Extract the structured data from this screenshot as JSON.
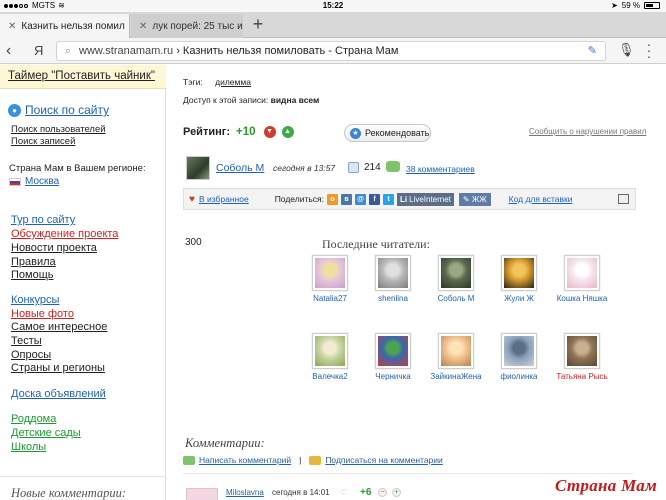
{
  "status": {
    "carrier": "MGTS",
    "time": "15:22",
    "battery": "59 %"
  },
  "tabs": [
    {
      "label": "Казнить нельзя помил",
      "active": true
    },
    {
      "label": "лук порей: 25 тыс изо",
      "active": false
    }
  ],
  "address": {
    "domain": "www.stranamam.ru",
    "separator": " › ",
    "title": "Казнить нельзя помиловать - Страна Мам"
  },
  "sidebar": {
    "timer": "Таймер \"Поставить чайник\"",
    "search": "Поиск по сайту",
    "search_users": "Поиск пользователей",
    "search_posts": "Поиск записей",
    "region_label": "Страна Мам в Вашем регионе:",
    "region": "Москва",
    "links_group1": [
      {
        "label": "Тур по сайту",
        "color": "blue"
      },
      {
        "label": "Обсуждение проекта",
        "color": "red"
      },
      {
        "label": "Новости проекта",
        "color": "dark"
      },
      {
        "label": "Правила",
        "color": "dark"
      },
      {
        "label": "Помощь",
        "color": "dark"
      }
    ],
    "links_group2": [
      {
        "label": "Конкурсы",
        "color": "blue"
      },
      {
        "label": "Новые фото",
        "color": "red"
      },
      {
        "label": "Самое интересное",
        "color": "dark"
      },
      {
        "label": "Тесты",
        "color": "dark"
      },
      {
        "label": "Опросы",
        "color": "dark"
      },
      {
        "label": "Страны и регионы",
        "color": "dark"
      }
    ],
    "links_group3": [
      {
        "label": "Доска объявлений",
        "color": "blue"
      }
    ],
    "links_group4": [
      {
        "label": "Роддома",
        "color": "green"
      },
      {
        "label": "Детские сады",
        "color": "green"
      },
      {
        "label": "Школы",
        "color": "green"
      }
    ],
    "new_comments": "Новые комментарии:"
  },
  "post": {
    "tags_label": "Тэги:",
    "tag": "дилемма",
    "access_label": "Доступ к этой записи:",
    "access_value": "видна всем",
    "rating_label": "Рейтинг:",
    "rating_value": "+10",
    "recommend": "Рекомендовать",
    "report": "Сообщить о нарушении правил",
    "author": "Соболь М",
    "time": "сегодня в 13:57",
    "views": "214",
    "comments_link": "38 комментариев",
    "favorites": "В избранное",
    "share_label": "Поделиться:",
    "liveinternet": "LiveInternet",
    "lj": "ЖЖ",
    "embed": "Код для вставки",
    "count": "300",
    "readers_title": "Последние читатели:"
  },
  "readers": [
    {
      "name": "Natalia27",
      "red": false,
      "colors": [
        "#e8c6d8",
        "#c9a0c8",
        "#f0e0a0"
      ]
    },
    {
      "name": "shenlina",
      "red": false,
      "colors": [
        "#b9b9b9",
        "#7d7d7d",
        "#e0e0e0"
      ]
    },
    {
      "name": "Соболь М",
      "red": false,
      "colors": [
        "#5a6b4c",
        "#2b3727",
        "#9aa888"
      ]
    },
    {
      "name": "Жули Ж",
      "red": false,
      "colors": [
        "#d49b2e",
        "#2c2316",
        "#f3c35c"
      ]
    },
    {
      "name": "Кошка Няшка",
      "red": false,
      "colors": [
        "#f6e4ec",
        "#e6b7c9",
        "#ffffff"
      ]
    },
    {
      "name": "Валечка2",
      "red": false,
      "colors": [
        "#c6d6a2",
        "#8aa45a",
        "#f3ead0"
      ]
    },
    {
      "name": "Черничка",
      "red": false,
      "colors": [
        "#3b66b0",
        "#c23f3f",
        "#4ba24f"
      ]
    },
    {
      "name": "ЗайкинаЖена",
      "red": false,
      "colors": [
        "#f0c38e",
        "#b58255",
        "#ffe1b8"
      ]
    },
    {
      "name": "фиолинка",
      "red": false,
      "colors": [
        "#8aa0b8",
        "#c9d3dc",
        "#5c6e84"
      ]
    },
    {
      "name": "Татьяна Рысь",
      "red": true,
      "colors": [
        "#8f7457",
        "#5b4631",
        "#c7b08e"
      ]
    }
  ],
  "comments": {
    "title": "Комментарии:",
    "write": "Написать комментарий",
    "subscribe": "Подписаться на комментарии",
    "first_author": "Miloslavna",
    "first_time": "сегодня в 14:01",
    "first_rating": "+6"
  },
  "watermark": "Страна Мам"
}
